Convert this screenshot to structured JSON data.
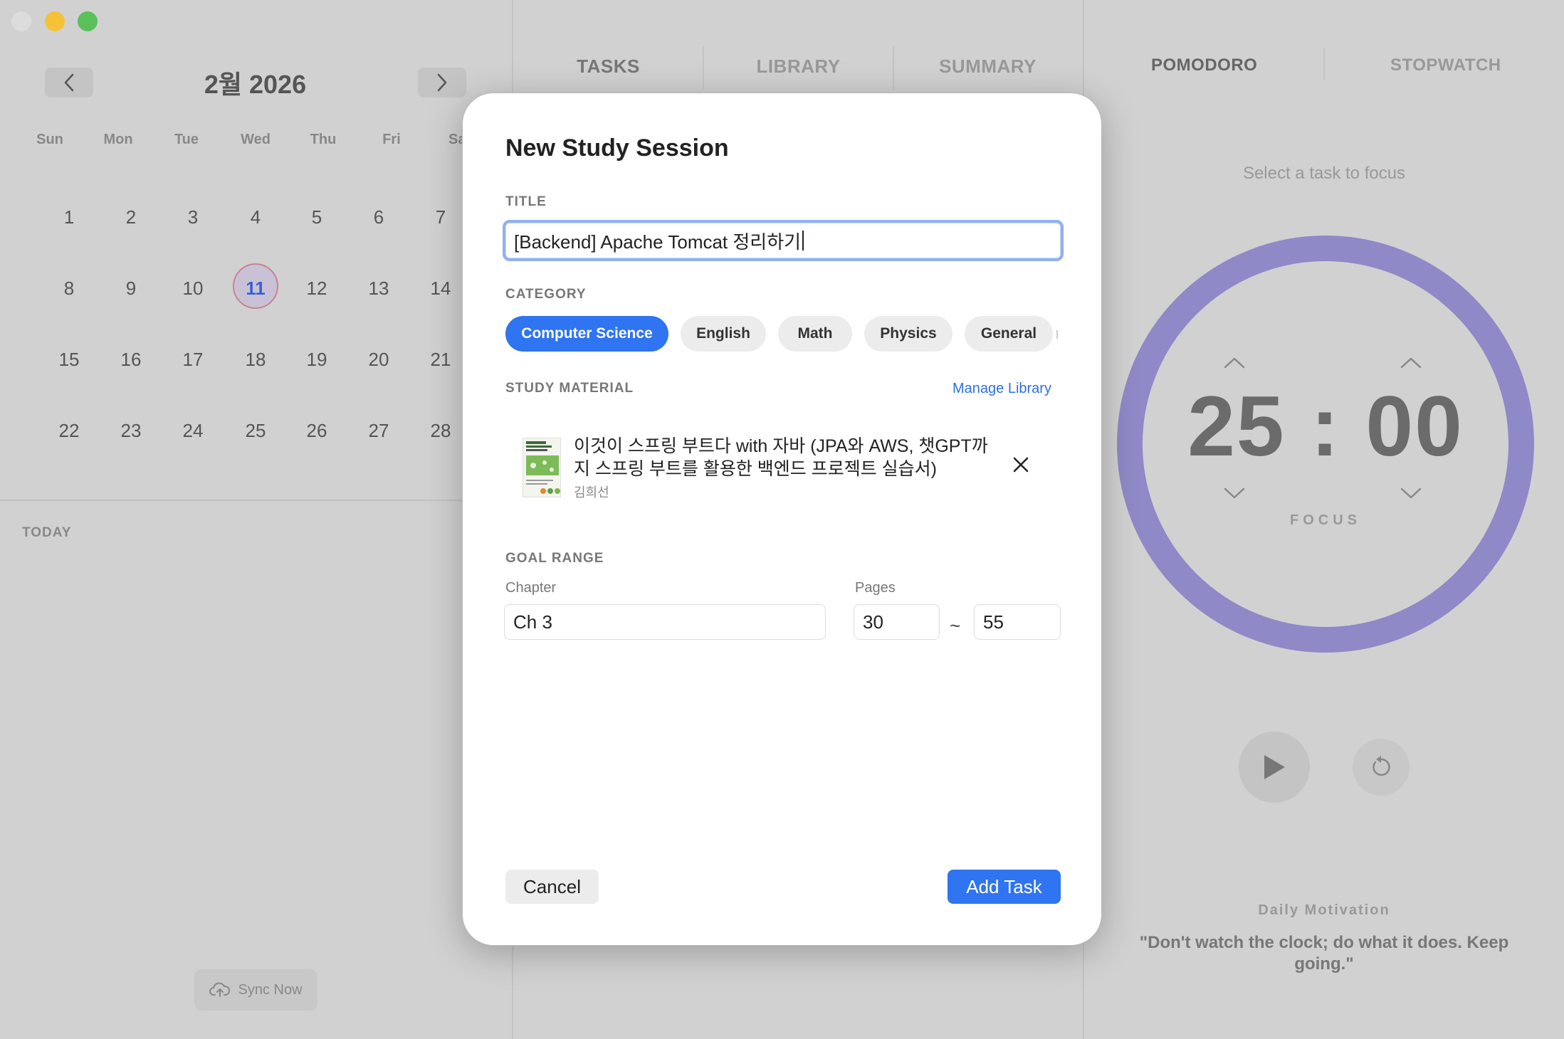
{
  "calendar": {
    "month_label": "2월 2026",
    "weekdays": [
      "Sun",
      "Mon",
      "Tue",
      "Wed",
      "Thu",
      "Fri",
      "Sa"
    ],
    "weeks": [
      [
        "1",
        "2",
        "3",
        "4",
        "5",
        "6",
        "7"
      ],
      [
        "8",
        "9",
        "10",
        "11",
        "12",
        "13",
        "14"
      ],
      [
        "15",
        "16",
        "17",
        "18",
        "19",
        "20",
        "21"
      ],
      [
        "22",
        "23",
        "24",
        "25",
        "26",
        "27",
        "28"
      ]
    ],
    "selected_day": "11",
    "today_label": "TODAY",
    "sync_label": "Sync Now"
  },
  "tabs": [
    "TASKS",
    "LIBRARY",
    "SUMMARY"
  ],
  "timer_panel": {
    "tabs": [
      "POMODORO",
      "STOPWATCH"
    ],
    "hint": "Select a task to focus",
    "minutes": "25",
    "separator": ":",
    "seconds": "00",
    "mode_label": "FOCUS",
    "motivation_title": "Daily Motivation",
    "motivation_quote": "\"Don't watch the clock; do what it does. Keep going.\"",
    "ring_color": "#8f89c7"
  },
  "modal": {
    "title": "New Study Session",
    "title_section": "TITLE",
    "title_value": "[Backend] Apache Tomcat 정리하기",
    "category_section": "CATEGORY",
    "categories": [
      "Computer Science",
      "English",
      "Math",
      "Physics",
      "General"
    ],
    "selected_category": "Computer Science",
    "material_section": "STUDY MATERIAL",
    "manage_library": "Manage Library",
    "book_title": "이것이 스프링 부트다 with 자바 (JPA와 AWS, 챗GPT까지 스프링 부트를 활용한 백엔드 프로젝트 실습서)",
    "book_author": "김희선",
    "goal_section": "GOAL RANGE",
    "chapter_label": "Chapter",
    "chapter_value": "Ch 3",
    "pages_label": "Pages",
    "page_from": "30",
    "page_sep": "~",
    "page_to": "55",
    "cancel_label": "Cancel",
    "add_label": "Add Task",
    "accent_color": "#2f74f0"
  }
}
